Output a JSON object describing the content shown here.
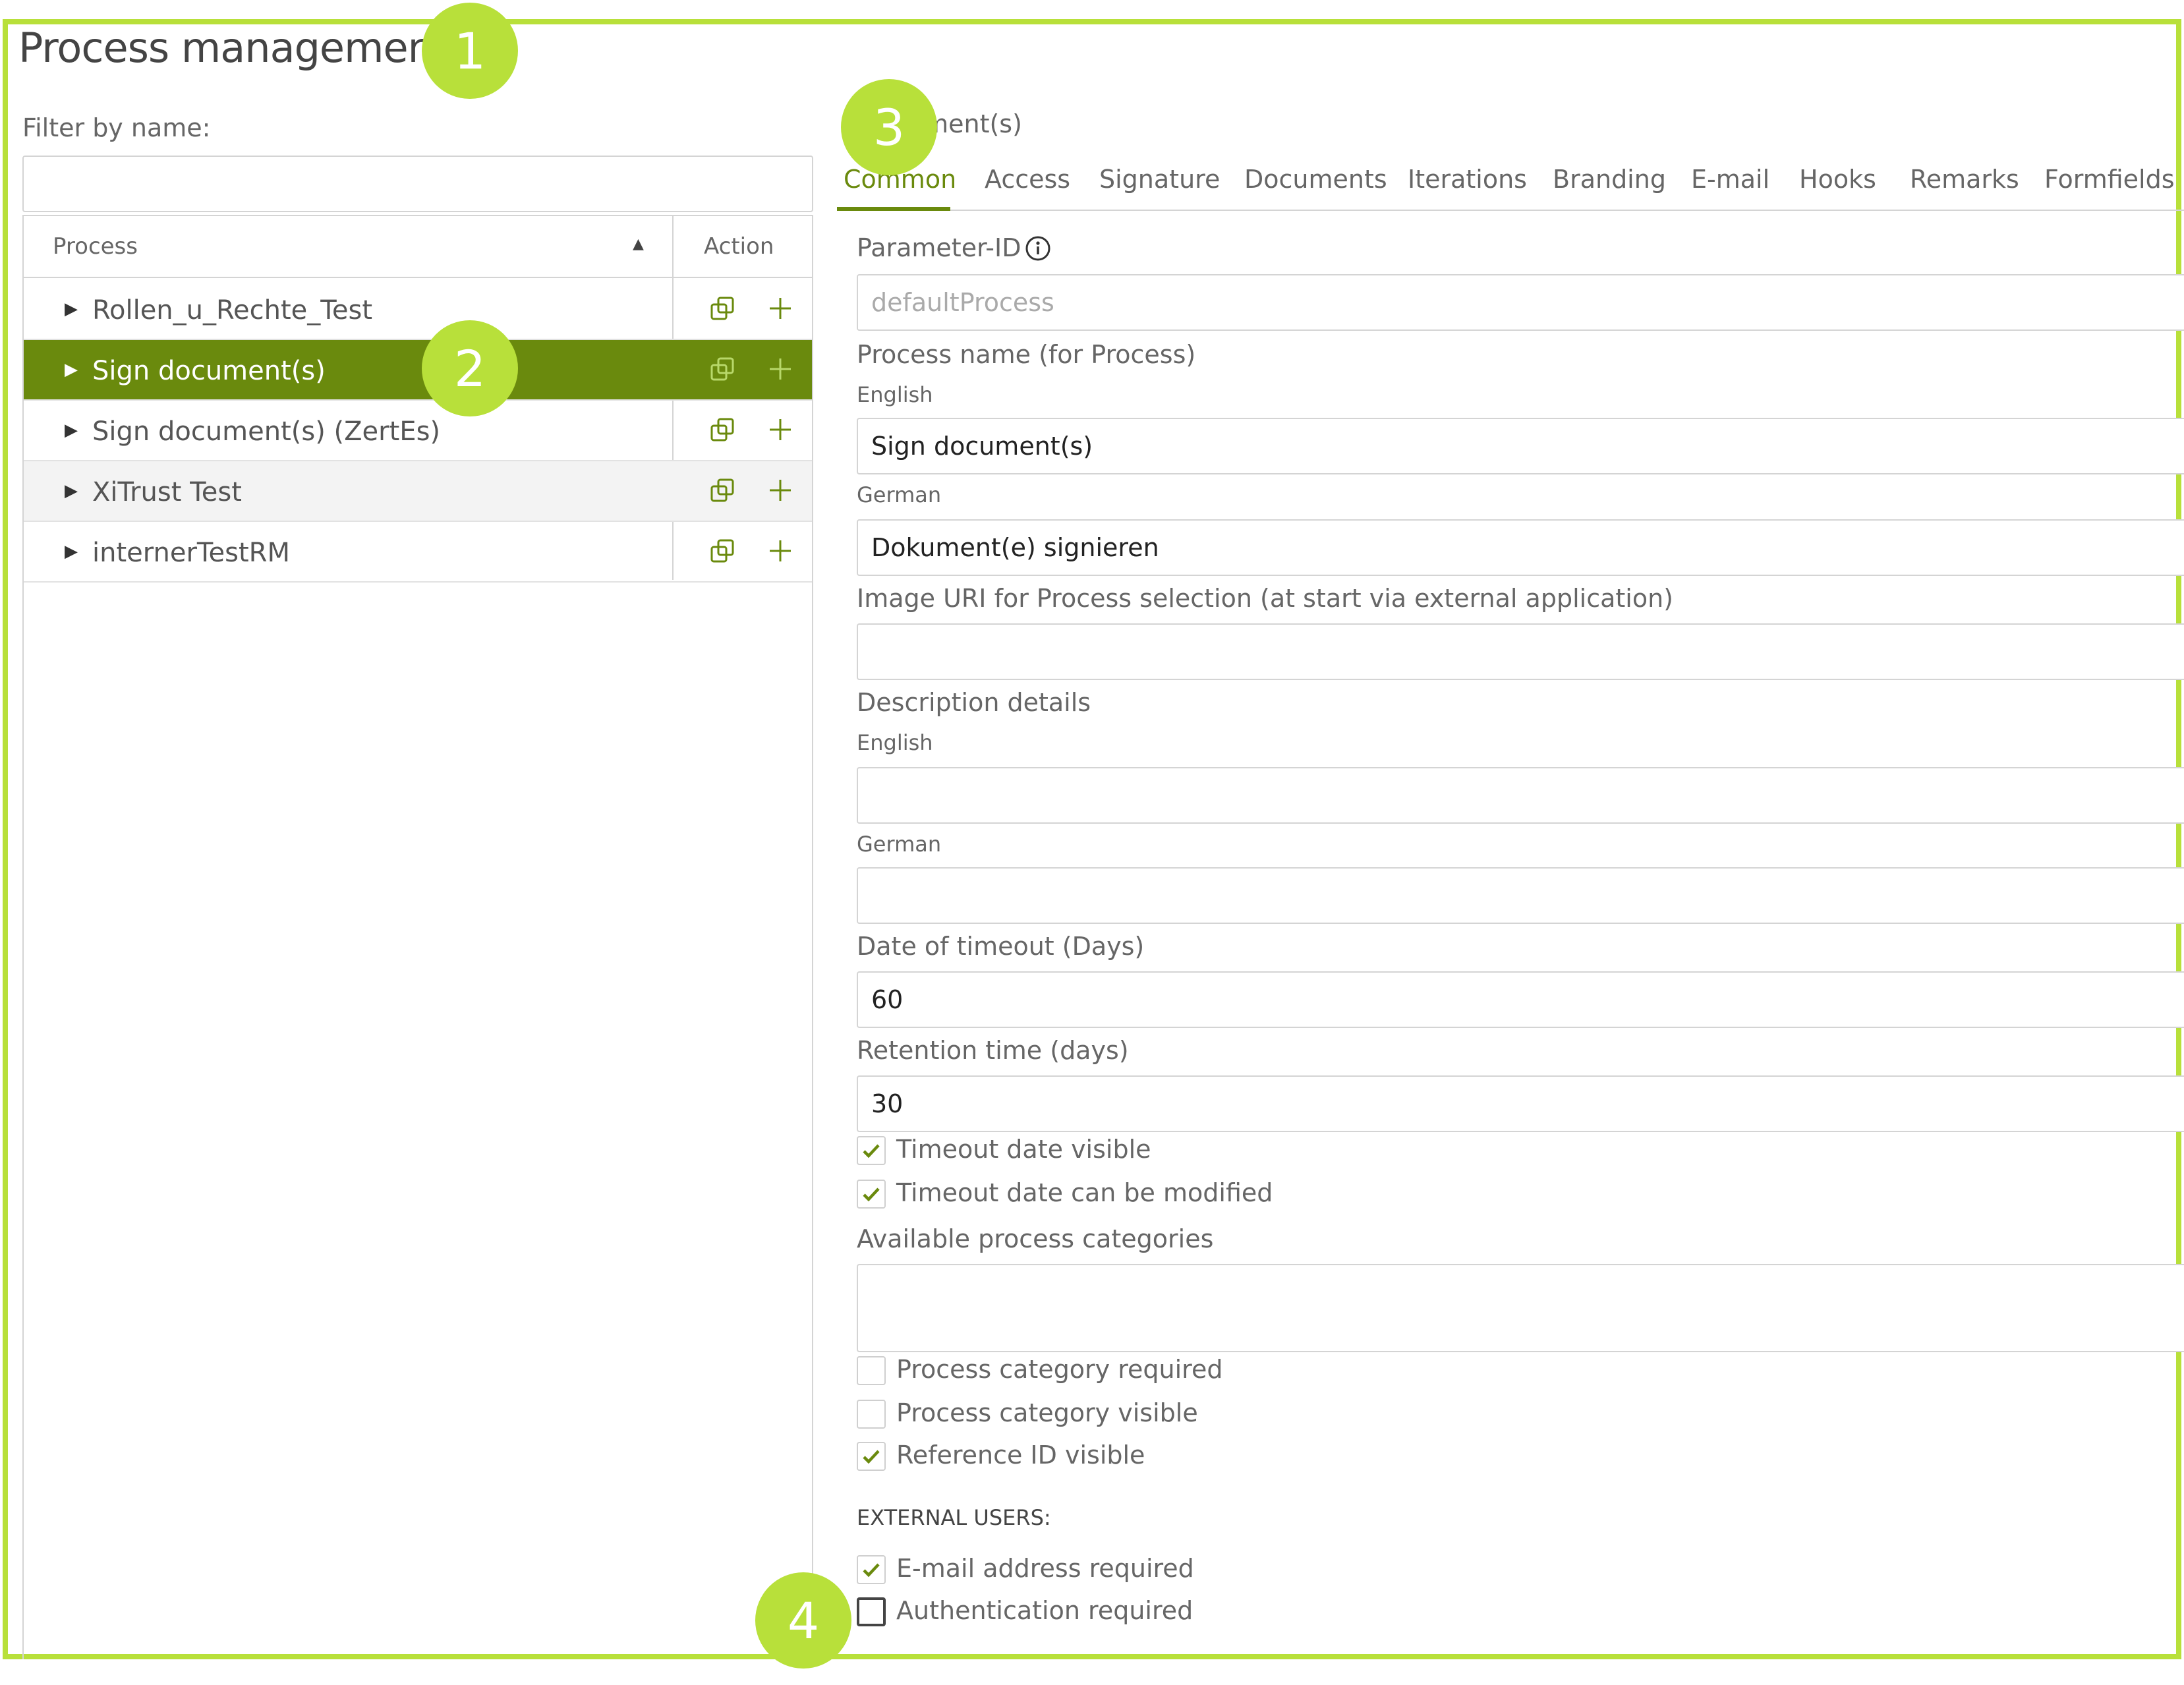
{
  "header": {
    "title": "Process management"
  },
  "filter": {
    "label": "Filter by name:",
    "value": "",
    "placeholder": ""
  },
  "table": {
    "col_process": "Process",
    "col_action": "Action",
    "rows": [
      {
        "label": "Rollen_u_Rechte_Test"
      },
      {
        "label": "Sign document(s)"
      },
      {
        "label": "Sign document(s) (ZertEs)"
      },
      {
        "label": "XiTrust Test"
      },
      {
        "label": "internerTestRM"
      }
    ]
  },
  "detail": {
    "process_name_visible": "ument(s)",
    "tabs": [
      "Common",
      "Access",
      "Signature",
      "Documents",
      "Iterations",
      "Branding",
      "E-mail",
      "Hooks",
      "Remarks",
      "Formfields"
    ],
    "fields": {
      "parameter_id_label": "Parameter-ID",
      "parameter_id_value": "defaultProcess",
      "process_name_label": "Process name (for Process)",
      "english_label": "English",
      "english_value": "Sign document(s)",
      "german_label": "German",
      "german_value": "Dokument(e) signieren",
      "image_uri_label": "Image URI for Process selection (at start via external application)",
      "image_uri_value": "",
      "description_label": "Description details",
      "desc_english_label": "English",
      "desc_english_value": "",
      "desc_german_label": "German",
      "desc_german_value": "",
      "timeout_label": "Date of timeout (Days)",
      "timeout_value": "60",
      "retention_label": "Retention time (days)",
      "retention_value": "30",
      "categories_label": "Available process categories",
      "external_users_label": "EXTERNAL USERS:"
    },
    "checkboxes": {
      "timeout_visible": {
        "label": "Timeout date visible",
        "checked": true
      },
      "timeout_modifiable": {
        "label": "Timeout date can be modified",
        "checked": true
      },
      "category_required": {
        "label": "Process category required",
        "checked": false
      },
      "category_visible": {
        "label": "Process category visible",
        "checked": false
      },
      "reference_visible": {
        "label": "Reference ID visible",
        "checked": true
      },
      "email_required": {
        "label": "E-mail address required",
        "checked": true
      },
      "auth_required": {
        "label": "Authentication required",
        "checked": false
      }
    }
  },
  "callouts": [
    "1",
    "2",
    "3",
    "4"
  ],
  "colors": {
    "accent": "#b8e03a",
    "selected_row": "#6a8a0d",
    "tab_active": "#6a8a0d"
  }
}
